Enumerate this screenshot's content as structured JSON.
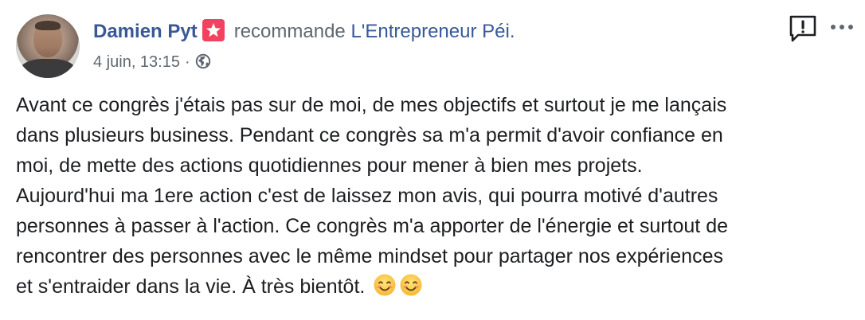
{
  "post": {
    "author": "Damien Pyt",
    "recommend_text": "recommande",
    "page_name": "L'Entrepreneur Péi.",
    "date": "4 juin, 13:15",
    "separator": "·",
    "icons": {
      "badge": "recommendation-star-icon",
      "privacy": "globe-icon",
      "report": "report-exclamation-icon",
      "more": "more-dots-icon",
      "emoji": "smiling-face-emoji-icon"
    },
    "colors": {
      "author_link": "#385898",
      "badge": "#f3425f",
      "meta_text": "#606770",
      "body_text": "#1c1e21"
    },
    "body_lines": [
      "Avant ce congrès j'étais pas sur de moi, de mes objectifs et surtout je me lançais",
      "dans plusieurs business. Pendant ce congrès sa m'a permit d'avoir confiance en",
      "moi, de mette des actions quotidiennes pour mener à bien mes projets.",
      "Aujourd'hui ma 1ere action c'est de laissez mon avis, qui pourra motivé d'autres",
      "personnes à passer à l'action. Ce congrès m'a apporter de l'énergie et surtout de",
      "rencontrer des personnes avec le même mindset pour partager nos expériences",
      "et s'entraider dans la vie. À très bientôt."
    ]
  }
}
